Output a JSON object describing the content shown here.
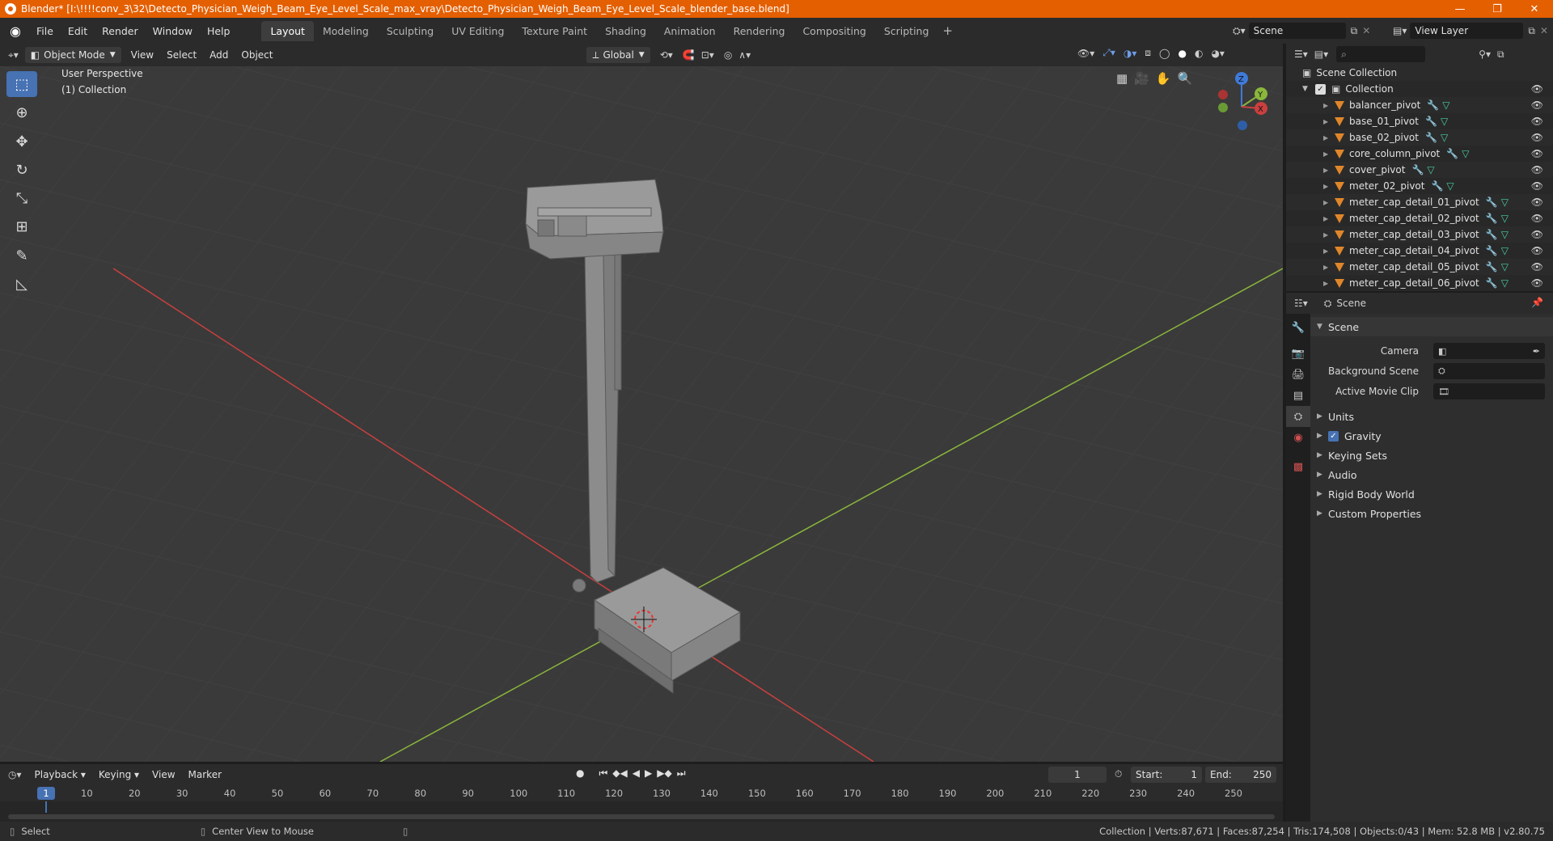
{
  "window": {
    "title": "Blender* [I:\\!!!!conv_3\\32\\Detecto_Physician_Weigh_Beam_Eye_Level_Scale_max_vray\\Detecto_Physician_Weigh_Beam_Eye_Level_Scale_blender_base.blend]",
    "minimize": "—",
    "maximize": "❐",
    "close": "✕"
  },
  "menubar": {
    "menus": [
      "File",
      "Edit",
      "Render",
      "Window",
      "Help"
    ],
    "workspaces": [
      "Layout",
      "Modeling",
      "Sculpting",
      "UV Editing",
      "Texture Paint",
      "Shading",
      "Animation",
      "Rendering",
      "Compositing",
      "Scripting"
    ],
    "active_workspace": "Layout",
    "add_workspace": "+",
    "scene_name": "Scene",
    "view_layer": "View Layer"
  },
  "viewport_header": {
    "mode": "Object Mode",
    "menus": [
      "View",
      "Select",
      "Add",
      "Object"
    ],
    "orientation": "Global"
  },
  "viewport": {
    "perspective_label": "User Perspective",
    "collection_label": "(1) Collection",
    "gizmo": {
      "x": "X",
      "y": "Y",
      "z": "Z"
    }
  },
  "toolbar": {
    "tools": [
      {
        "name": "select-box-tool",
        "glyph": "⬚",
        "active": true
      },
      {
        "name": "cursor-tool",
        "glyph": "⊕",
        "active": false
      },
      {
        "name": "move-tool",
        "glyph": "✥",
        "active": false
      },
      {
        "name": "rotate-tool",
        "glyph": "↻",
        "active": false
      },
      {
        "name": "scale-tool",
        "glyph": "⤡",
        "active": false
      },
      {
        "name": "transform-tool",
        "glyph": "⊞",
        "active": false
      },
      {
        "name": "annotate-tool",
        "glyph": "✎",
        "active": false
      },
      {
        "name": "measure-tool",
        "glyph": "📐",
        "active": false
      }
    ]
  },
  "outliner": {
    "root": "Scene Collection",
    "collection": "Collection",
    "objects": [
      "balancer_pivot",
      "base_01_pivot",
      "base_02_pivot",
      "core_column_pivot",
      "cover_pivot",
      "meter_02_pivot",
      "meter_cap_detail_01_pivot",
      "meter_cap_detail_02_pivot",
      "meter_cap_detail_03_pivot",
      "meter_cap_detail_04_pivot",
      "meter_cap_detail_05_pivot",
      "meter_cap_detail_06_pivot"
    ]
  },
  "properties": {
    "header": "Scene",
    "section": "Scene",
    "fields": [
      {
        "label": "Camera",
        "value": ""
      },
      {
        "label": "Background Scene",
        "value": ""
      },
      {
        "label": "Active Movie Clip",
        "value": ""
      }
    ],
    "subsections": [
      "Units",
      "Gravity",
      "Keying Sets",
      "Audio",
      "Rigid Body World",
      "Custom Properties"
    ],
    "gravity_checked": true
  },
  "timeline": {
    "menus": [
      "Playback",
      "Keying",
      "View",
      "Marker"
    ],
    "current_frame": "1",
    "start_label": "Start:",
    "start": "1",
    "end_label": "End:",
    "end": "250",
    "ticks": [
      "1",
      "10",
      "20",
      "30",
      "40",
      "50",
      "60",
      "70",
      "80",
      "90",
      "100",
      "110",
      "120",
      "130",
      "140",
      "150",
      "160",
      "170",
      "180",
      "190",
      "200",
      "210",
      "220",
      "230",
      "240",
      "250"
    ]
  },
  "statusbar": {
    "left_action": "Select",
    "middle_action": "Center View to Mouse",
    "stats": "Collection | Verts:87,671 | Faces:87,254 | Tris:174,508 | Objects:0/43 | Mem: 52.8 MB | v2.80.75"
  },
  "colors": {
    "accent": "#4772b3",
    "titlebar": "#e45f00",
    "x_axis": "#c9403f",
    "y_axis": "#8bb63c",
    "z_axis": "#3f7ad9",
    "object_icon": "#e0862a"
  }
}
